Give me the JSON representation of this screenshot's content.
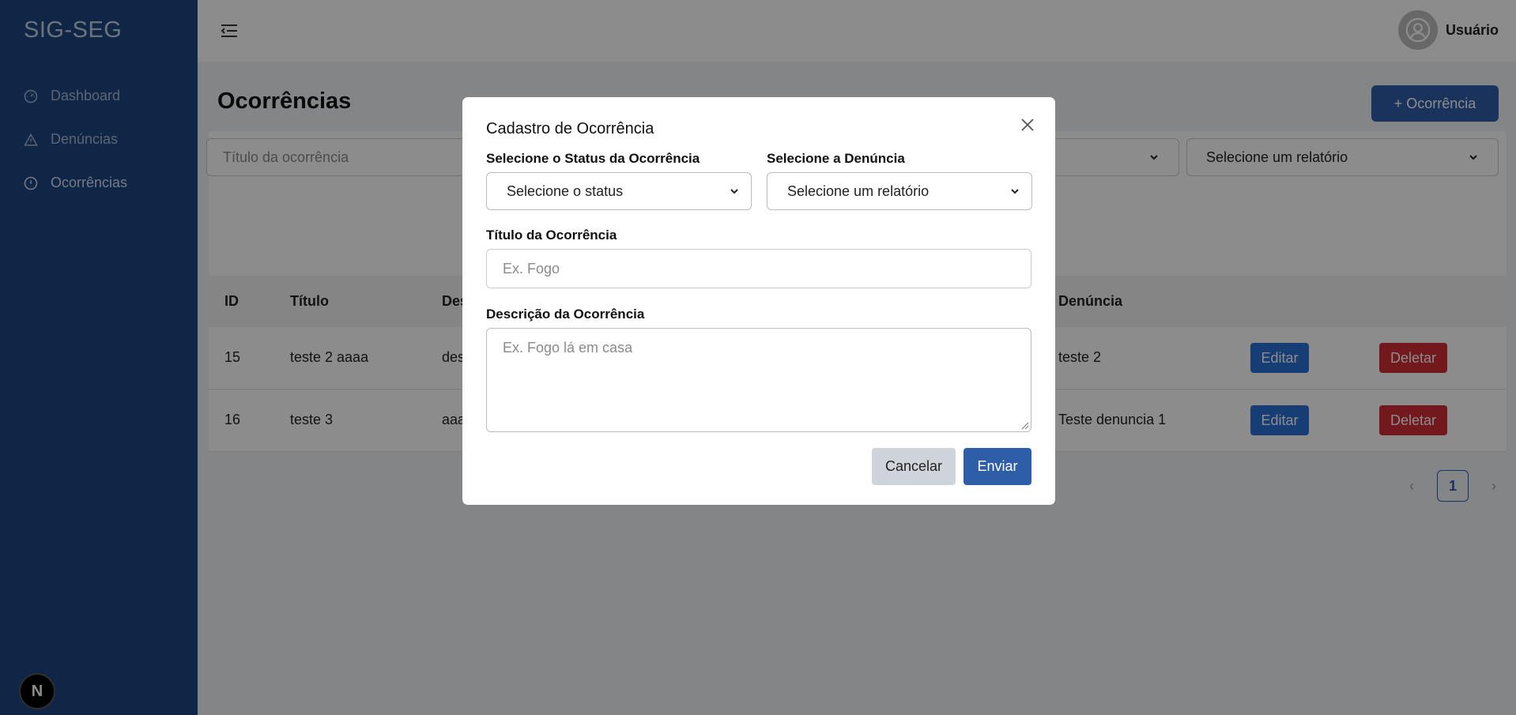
{
  "sidebar": {
    "brand": "SIG-SEG",
    "items": [
      {
        "label": "Dashboard",
        "icon": "gauge-icon"
      },
      {
        "label": "Denúncias",
        "icon": "warning-icon"
      },
      {
        "label": "Ocorrências",
        "icon": "alert-circle-icon",
        "active": true
      }
    ],
    "badge": "N"
  },
  "topbar": {
    "user_name": "Usuário"
  },
  "main": {
    "title": "Ocorrências",
    "add_button": "+ Ocorrência",
    "filters": {
      "title_placeholder": "Título da ocorrência",
      "report_select": "Selecione um relatório"
    },
    "table": {
      "headers": [
        "ID",
        "Título",
        "Des",
        "Denúncia"
      ],
      "rows": [
        {
          "id": "15",
          "title": "teste 2 aaaa",
          "desc": "des",
          "denuncia": "teste 2",
          "edit": "Editar",
          "delete": "Deletar"
        },
        {
          "id": "16",
          "title": "teste 3",
          "desc": "aaa",
          "denuncia": "Teste denuncia 1",
          "edit": "Editar",
          "delete": "Deletar"
        }
      ]
    },
    "pagination": {
      "current": "1"
    }
  },
  "modal": {
    "title": "Cadastro de Ocorrência",
    "status_label": "Selecione o Status da Ocorrência",
    "status_value": "Selecione o status",
    "denuncia_label": "Selecione a Denúncia",
    "denuncia_value": "Selecione um relatório",
    "title_label": "Título da Ocorrência",
    "title_placeholder": "Ex. Fogo",
    "desc_label": "Descrição da Ocorrência",
    "desc_placeholder": "Ex. Fogo lá em casa",
    "cancel": "Cancelar",
    "submit": "Enviar"
  },
  "colors": {
    "sidebar": "#1e4582",
    "primary": "#2f5ea8",
    "edit": "#2b6fd6",
    "danger": "#d22c33"
  }
}
